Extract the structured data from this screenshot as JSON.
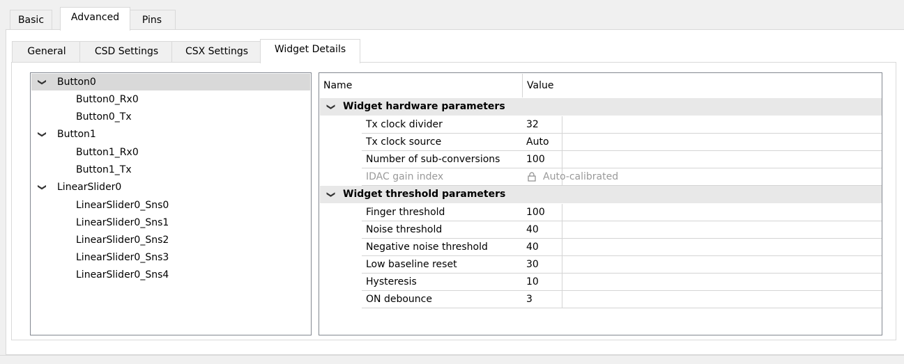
{
  "top_tabs": [
    "Basic",
    "Advanced",
    "Pins"
  ],
  "sub_tabs": [
    "General",
    "CSD Settings",
    "CSX Settings",
    "Widget Details"
  ],
  "tree": {
    "items": [
      {
        "label": "Button0",
        "expanded": true,
        "selected": true
      },
      {
        "label": "Button0_Rx0"
      },
      {
        "label": "Button0_Tx"
      },
      {
        "label": "Button1",
        "expanded": true
      },
      {
        "label": "Button1_Rx0"
      },
      {
        "label": "Button1_Tx"
      },
      {
        "label": "LinearSlider0",
        "expanded": true
      },
      {
        "label": "LinearSlider0_Sns0"
      },
      {
        "label": "LinearSlider0_Sns1"
      },
      {
        "label": "LinearSlider0_Sns2"
      },
      {
        "label": "LinearSlider0_Sns3"
      },
      {
        "label": "LinearSlider0_Sns4"
      }
    ]
  },
  "grid": {
    "header_name": "Name",
    "header_value": "Value",
    "hardware": {
      "title": "Widget hardware parameters",
      "rows": [
        {
          "name": "Tx clock divider",
          "value": "32"
        },
        {
          "name": "Tx clock source",
          "value": "Auto"
        },
        {
          "name": "Number of sub-conversions",
          "value": "100"
        },
        {
          "name": "IDAC gain index",
          "value": "Auto-calibrated",
          "disabled": true
        }
      ]
    },
    "threshold": {
      "title": "Widget threshold parameters",
      "rows": [
        {
          "name": "Finger threshold",
          "value": "100"
        },
        {
          "name": "Noise threshold",
          "value": "40"
        },
        {
          "name": "Negative noise threshold",
          "value": "40"
        },
        {
          "name": "Low baseline reset",
          "value": "30"
        },
        {
          "name": "Hysteresis",
          "value": "10"
        },
        {
          "name": "ON debounce",
          "value": "3"
        }
      ]
    }
  },
  "icons": {
    "expand": "chevron-down-icon",
    "locked": "lock-icon"
  }
}
